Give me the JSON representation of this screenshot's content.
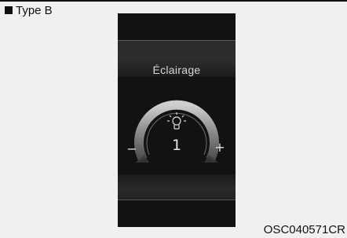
{
  "header": {
    "type_label": "Type B"
  },
  "screen": {
    "title": "Éclairage",
    "level": "1",
    "minus_symbol": "−",
    "plus_symbol": "+",
    "icon": "illumination-bulb-icon"
  },
  "caption": "OSC040571CR"
}
